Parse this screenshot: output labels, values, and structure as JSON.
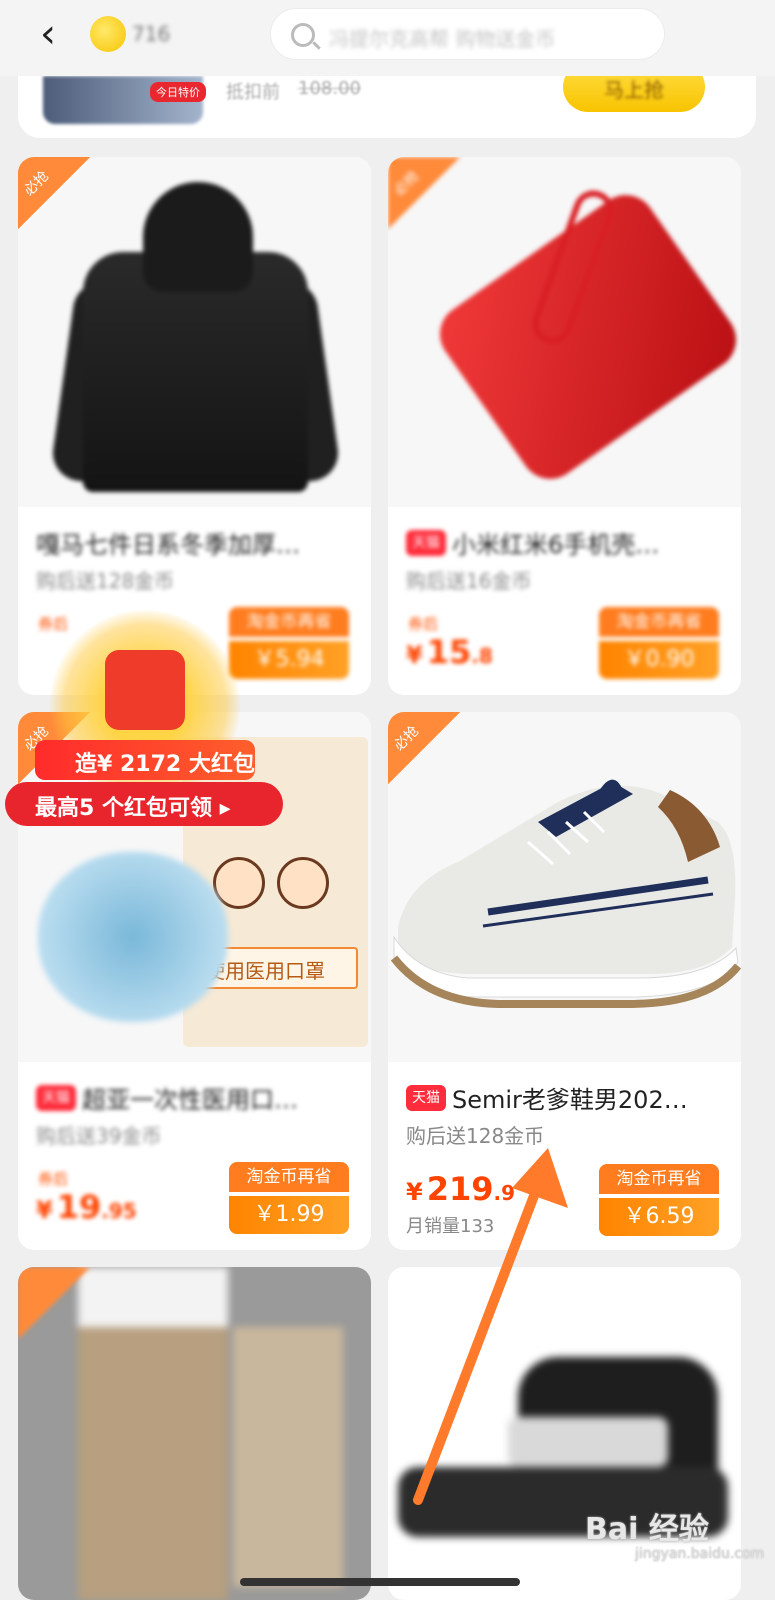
{
  "topbar": {
    "back_glyph": "‹",
    "coin_count": "716",
    "search_placeholder": "冯提尔克高帮 购物送金币"
  },
  "prev_item": {
    "tag": "今日特价",
    "price_label": "抵扣前",
    "original_price": "108.00",
    "button_label": "马上抢"
  },
  "products": [
    {
      "corner_label": "必抢",
      "brand_tag": "",
      "title": "嘎马七件日系冬季加厚…",
      "subtitle": "购后送128金币",
      "price_label": "券后",
      "price_int": "",
      "price_dec": "",
      "monthly_sales": "",
      "save_label": "淘金币再省",
      "save_amount": "￥5.94"
    },
    {
      "corner_label": "必抢",
      "brand_tag": "天猫",
      "title": "小米红米6手机壳…",
      "subtitle": "购后送16金币",
      "price_label": "券后",
      "price_int": "15",
      "price_dec": ".8",
      "monthly_sales": "",
      "save_label": "淘金币再省",
      "save_amount": "￥0.90"
    },
    {
      "corner_label": "必抢",
      "brand_tag": "天猫",
      "title": "超亚一次性医用口…",
      "subtitle": "购后送39金币",
      "price_label": "券后",
      "price_int": "19",
      "price_dec": ".95",
      "monthly_sales": "",
      "save_label": "淘金币再省",
      "save_amount": "￥1.99",
      "pack_text": "使用医用口罩"
    },
    {
      "corner_label": "必抢",
      "brand_tag": "天猫",
      "title": "Semir老爹鞋男202…",
      "subtitle": "购后送128金币",
      "price_label": "",
      "price_int": "219",
      "price_dec": ".9",
      "monthly_sales": "月销量133",
      "save_label": "淘金币再省",
      "save_amount": "￥6.59"
    },
    {
      "corner_label": ""
    },
    {
      "corner_label": ""
    }
  ],
  "red_packet": {
    "banner": "造¥ 2172 大红包",
    "bar": "最高5 个红包可领 ▸"
  },
  "watermark": {
    "logo": "Bai 经验",
    "sub": "jingyan.baidu.com"
  },
  "colors": {
    "accent_orange": "#ff7d1f",
    "price_red": "#ff4400",
    "coin_yellow": "#f7c400",
    "brand_red": "#ff2c3b"
  }
}
